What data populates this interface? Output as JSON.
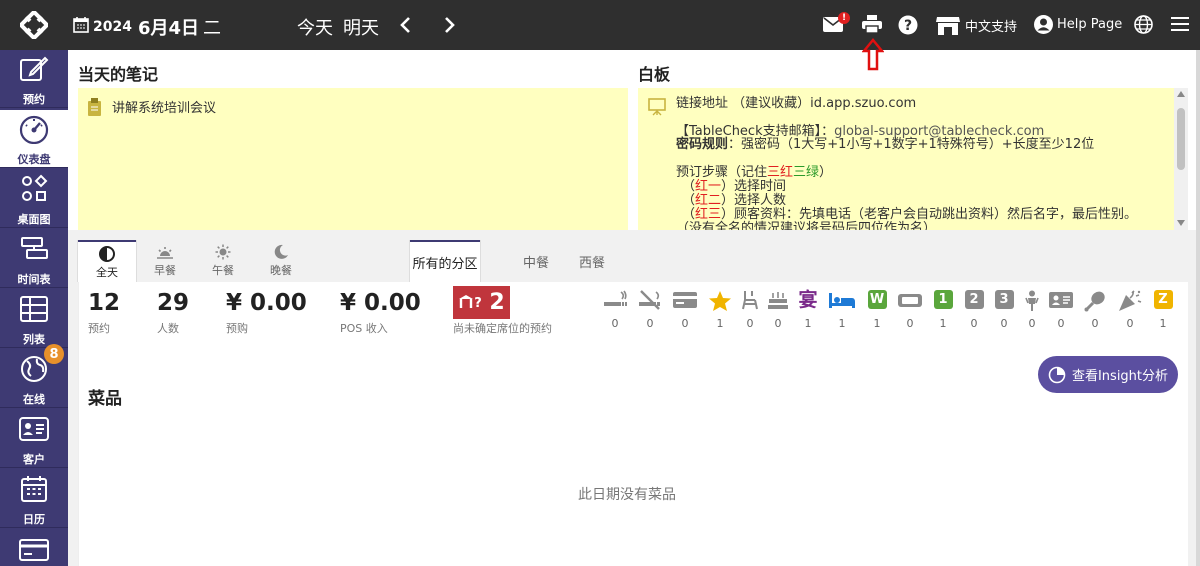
{
  "topbar": {
    "year": "2024",
    "date": "6月4日",
    "weekday": "二",
    "today": "今天",
    "tomorrow": "明天",
    "mail_badge": "!",
    "chinese_support": "中文支持",
    "help_page": "Help Page"
  },
  "sidebar": {
    "items": [
      {
        "label": "预约",
        "icon": "edit-icon"
      },
      {
        "label": "仪表盘",
        "icon": "dashboard-icon"
      },
      {
        "label": "桌面图",
        "icon": "floorplan-icon"
      },
      {
        "label": "时间表",
        "icon": "timetable-icon"
      },
      {
        "label": "列表",
        "icon": "list-icon"
      },
      {
        "label": "在线",
        "icon": "globe-icon",
        "badge": "8"
      },
      {
        "label": "客户",
        "icon": "customer-icon"
      },
      {
        "label": "日历",
        "icon": "calendar-icon"
      },
      {
        "label": "",
        "icon": "card-icon"
      }
    ]
  },
  "notes": {
    "title": "当天的笔记",
    "item": "讲解系统培训会议"
  },
  "whiteboard": {
    "title": "白板",
    "line1": "链接地址 （建议收藏）id.app.szuo.com",
    "line2a": "【TableCheck支持邮箱】：",
    "line2b": "global-support@tablecheck.com",
    "line3a": "密码规则",
    "line3b": "：强密码（1大写+1小写+1数字+1特殊符号）+长度至少12位",
    "line4a": "预订步骤（记住",
    "line4b": "三红",
    "line4c": "三绿",
    "line4d": "）",
    "line5a": "（",
    "line5b": "红一",
    "line5c": "）选择时间",
    "line6b": "红二",
    "line6c": "）选择人数",
    "line7b": "红三",
    "line7c": "）顾客资料：先填电话（老客户会自动跳出资料）然后名字，最后性别。",
    "line8": "（没有全名的情况建议将号码后四位作为名）"
  },
  "time_tabs": [
    "全天",
    "早餐",
    "午餐",
    "晚餐"
  ],
  "zone_tabs": [
    "所有的分区",
    "中餐",
    "西餐"
  ],
  "stats": [
    {
      "value": "12",
      "label": "预约"
    },
    {
      "value": "29",
      "label": "人数"
    },
    {
      "value": "¥ 0.00",
      "label": "预购"
    },
    {
      "value": "¥ 0.00",
      "label": "POS 收入"
    }
  ],
  "unassigned": {
    "value": "2",
    "label": "尚未确定席位的预约"
  },
  "icon_counts": [
    {
      "icon": "smoking-icon",
      "count": "0"
    },
    {
      "icon": "no-smoking-icon",
      "count": "0"
    },
    {
      "icon": "card-payment-icon",
      "count": "0"
    },
    {
      "icon": "star-icon",
      "count": "1"
    },
    {
      "icon": "high-chair-icon",
      "count": "0"
    },
    {
      "icon": "birthday-cake-icon",
      "count": "0"
    },
    {
      "icon": "banquet-icon",
      "text": "宴",
      "count": "1"
    },
    {
      "icon": "bed-icon",
      "count": "1"
    },
    {
      "icon": "w-badge-icon",
      "text": "W",
      "count": "1"
    },
    {
      "icon": "seat-icon",
      "count": "0"
    },
    {
      "icon": "one-badge-icon",
      "text": "1",
      "count": "1"
    },
    {
      "icon": "two-badge-icon",
      "text": "2",
      "count": "0"
    },
    {
      "icon": "three-badge-icon",
      "text": "3",
      "count": "0"
    },
    {
      "icon": "person-icon",
      "count": "0"
    },
    {
      "icon": "id-card-icon",
      "count": "0"
    },
    {
      "icon": "meat-icon",
      "count": "0"
    },
    {
      "icon": "party-icon",
      "count": "0"
    },
    {
      "icon": "z-badge-icon",
      "text": "Z",
      "count": "1"
    }
  ],
  "colors": {
    "sidebar": "#3e3a73",
    "accent": "#5b4fa0",
    "note_bg": "#ffffc0",
    "star": "#f0b400",
    "green": "#4caf50",
    "unassigned": "#c0353c"
  },
  "insight_button": "查看Insight分析",
  "dishes": {
    "title": "菜品",
    "empty": "此日期没有菜品"
  }
}
